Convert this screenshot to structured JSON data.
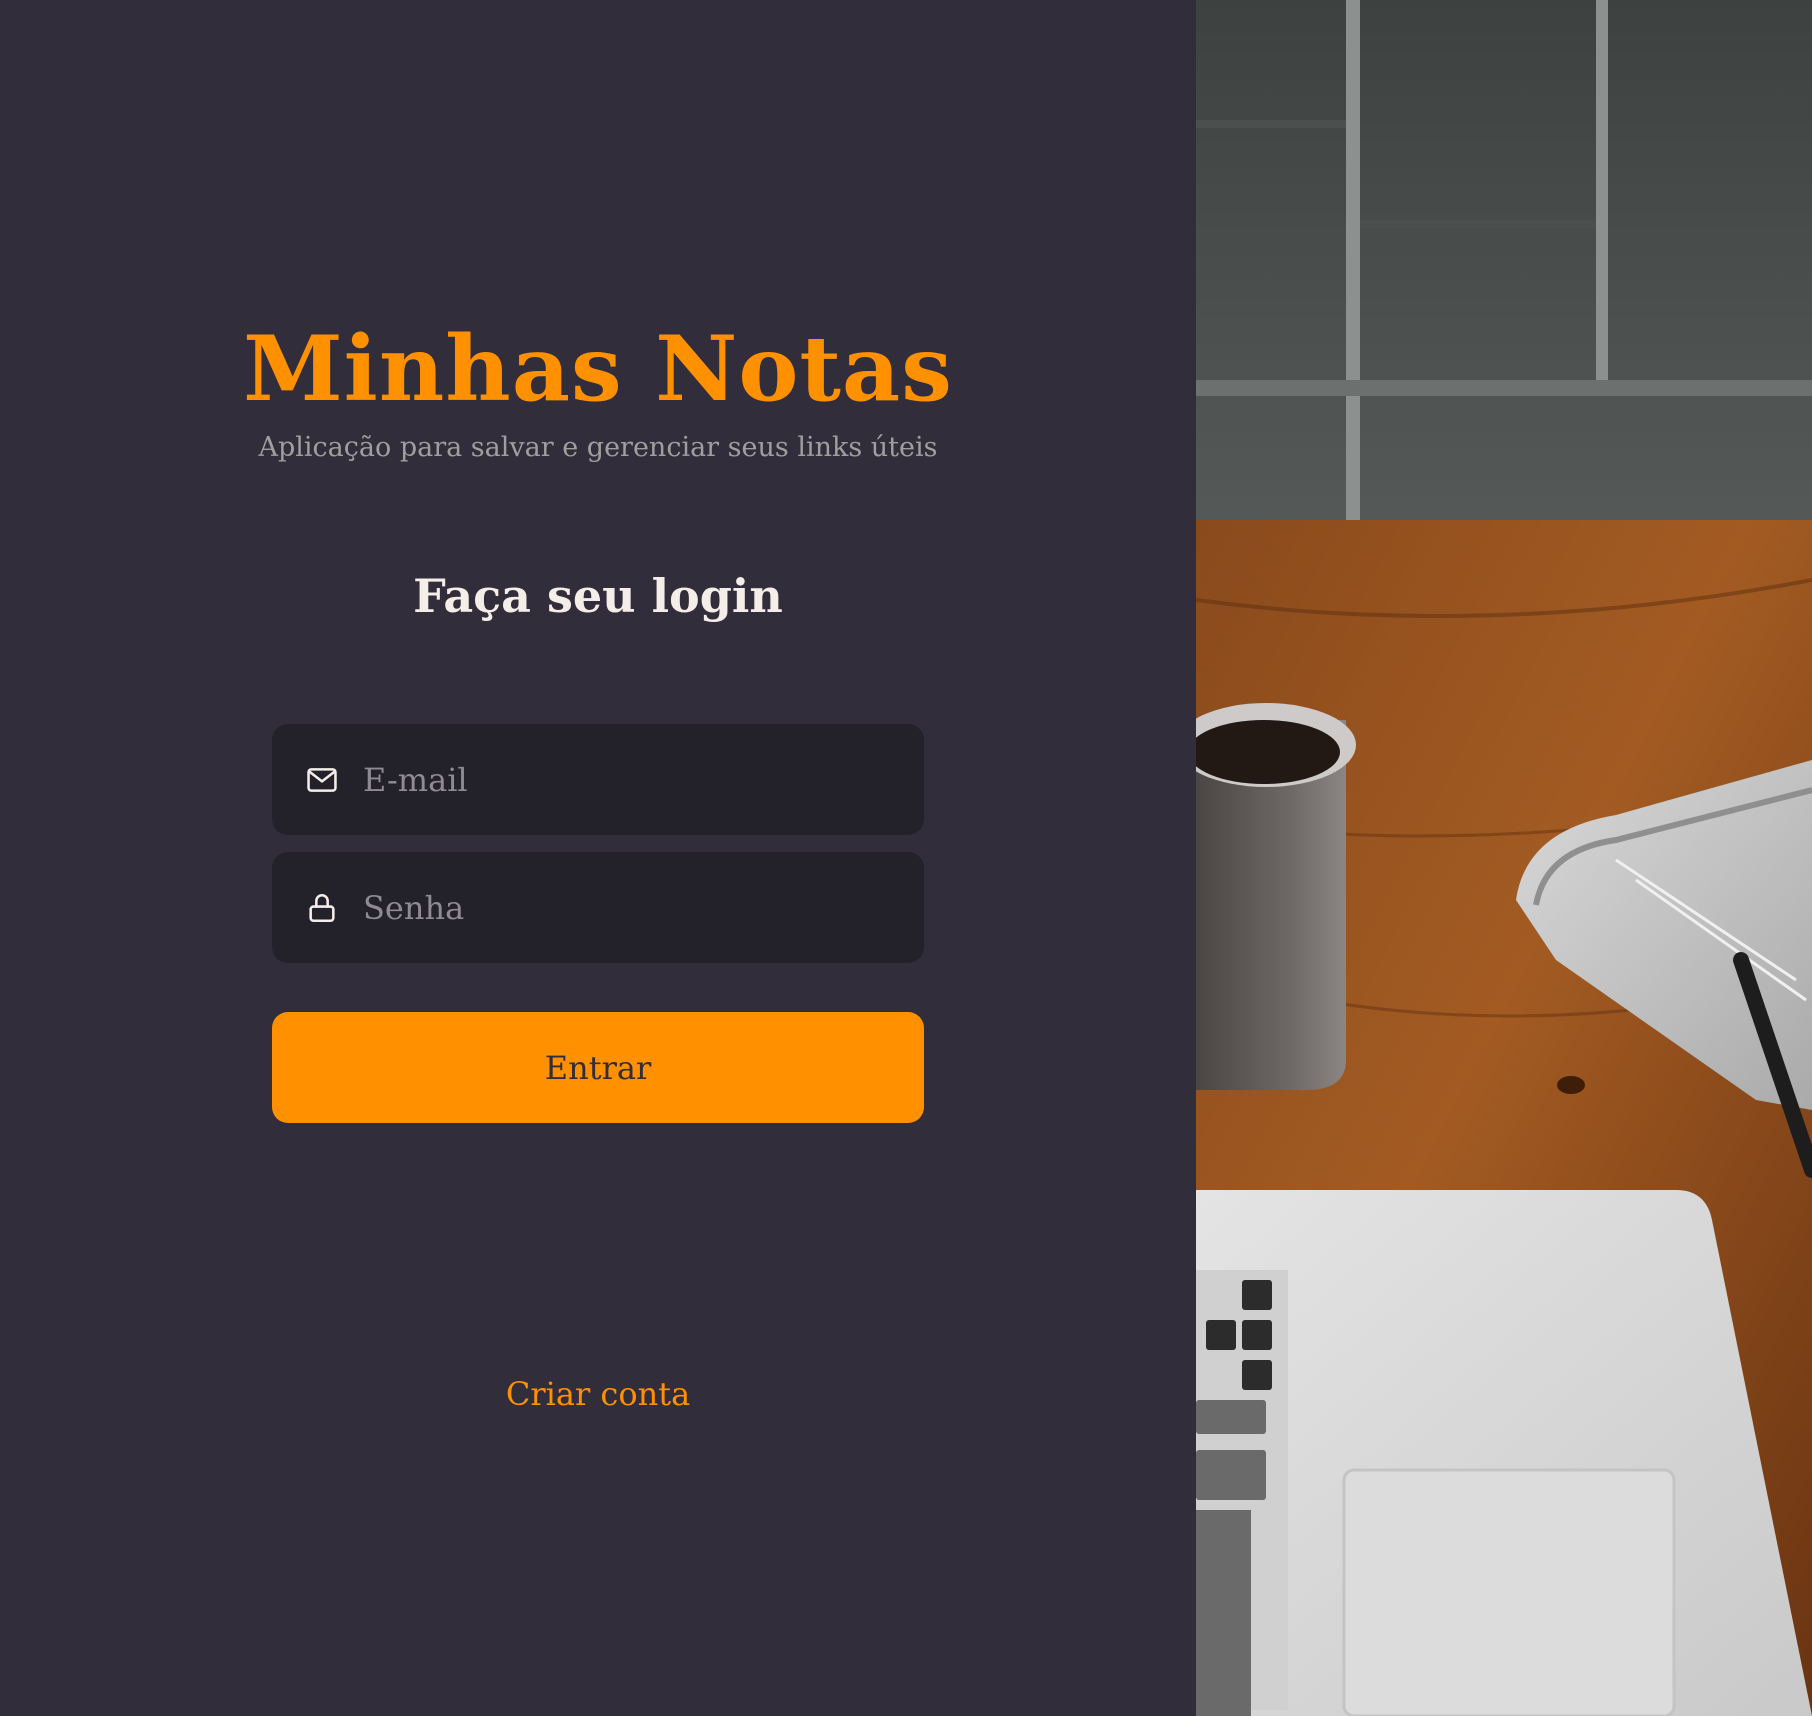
{
  "brand": {
    "title": "Minhas Notas",
    "subtitle": "Aplicação para salvar e gerenciar seus links úteis"
  },
  "form": {
    "title": "Faça seu login",
    "email": {
      "placeholder": "E-mail",
      "value": "",
      "icon": "mail-icon"
    },
    "password": {
      "placeholder": "Senha",
      "value": "",
      "icon": "lock-icon"
    },
    "submit_label": "Entrar"
  },
  "links": {
    "create_account": "Criar conta"
  },
  "colors": {
    "background": "#312d3a",
    "accent": "#ff9000",
    "input_background": "#232129",
    "heading_text": "#f4ede8",
    "muted_text": "#a19e9f"
  },
  "background_image": "desk-photo-coffee-newspaper-laptop"
}
